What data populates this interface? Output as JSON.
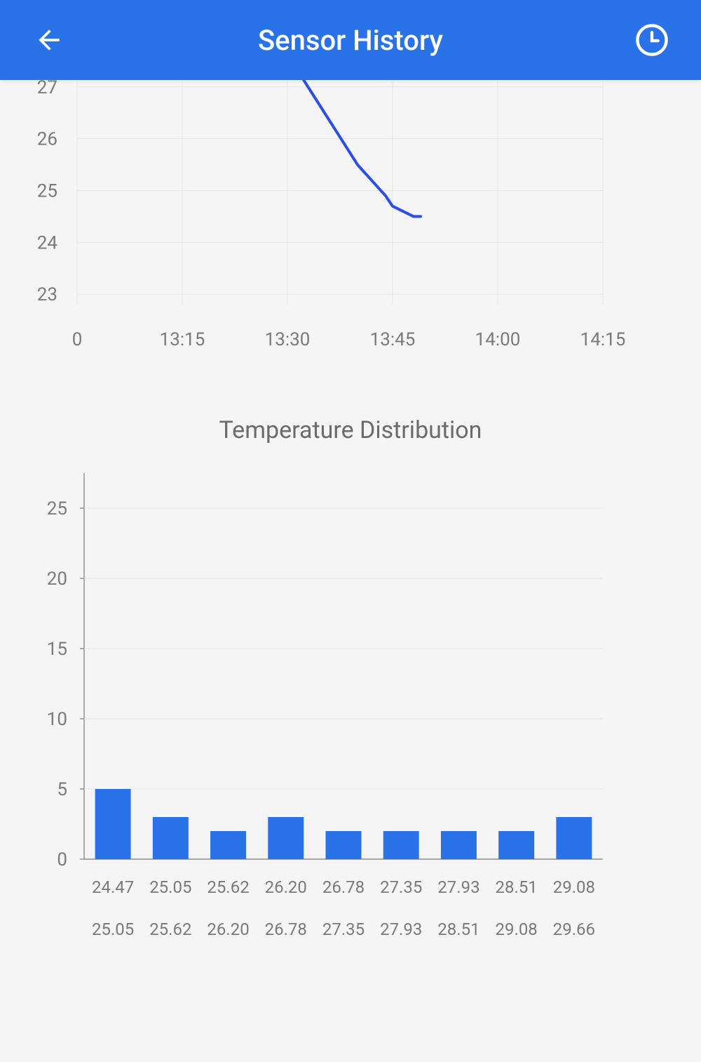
{
  "header": {
    "title": "Sensor History",
    "back_icon": "arrow-left",
    "clock_icon": "clock"
  },
  "chart_data": [
    {
      "type": "line",
      "title": "",
      "x_ticks": [
        "0",
        "13:15",
        "13:30",
        "13:45",
        "14:00",
        "14:15"
      ],
      "y_ticks": [
        23,
        24,
        25,
        26,
        27
      ],
      "ylim": [
        22.8,
        27.2
      ],
      "xlim_minutes": [
        790,
        862
      ],
      "series": [
        {
          "name": "temperature",
          "points": [
            {
              "t": "13:32",
              "v": 27.2
            },
            {
              "t": "13:40",
              "v": 25.5
            },
            {
              "t": "13:44",
              "v": 24.9
            },
            {
              "t": "13:45",
              "v": 24.7
            },
            {
              "t": "13:48",
              "v": 24.5
            },
            {
              "t": "13:49",
              "v": 24.5
            }
          ]
        }
      ]
    },
    {
      "type": "bar",
      "title": "Temperature Distribution",
      "y_ticks": [
        0,
        5,
        10,
        15,
        20,
        25
      ],
      "ylim": [
        0,
        27
      ],
      "categories_top": [
        "24.47",
        "25.05",
        "25.62",
        "26.20",
        "26.78",
        "27.35",
        "27.93",
        "28.51",
        "29.08"
      ],
      "categories_bottom": [
        "25.05",
        "25.62",
        "26.20",
        "26.78",
        "27.35",
        "27.93",
        "28.51",
        "29.08",
        "29.66"
      ],
      "values": [
        5,
        3,
        2,
        3,
        2,
        2,
        2,
        2,
        3
      ]
    }
  ]
}
